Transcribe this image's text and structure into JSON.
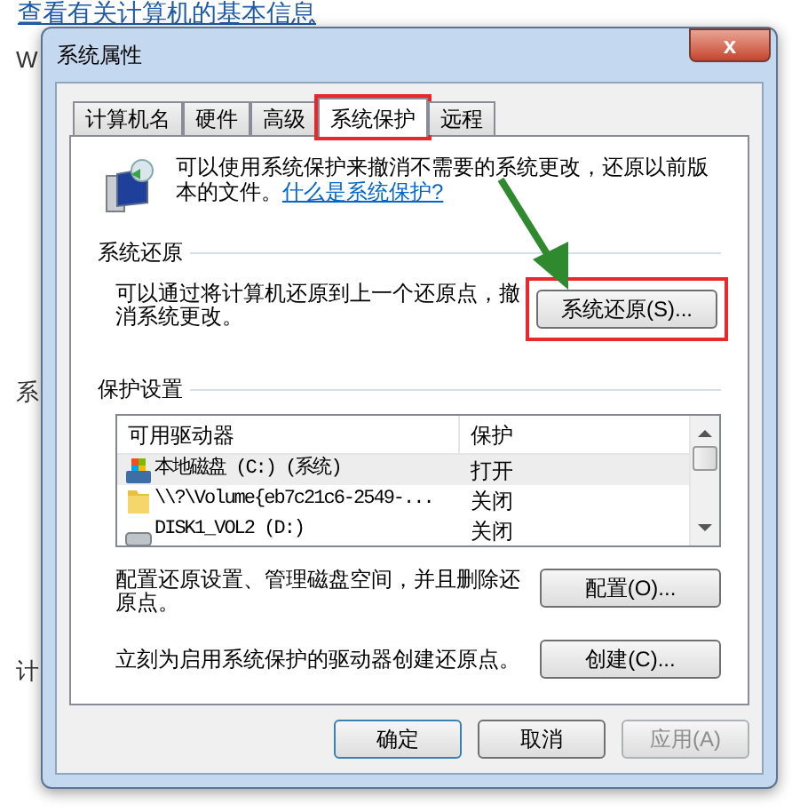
{
  "background": {
    "heading_link": "查看有关计算机的基本信息",
    "fragments": [
      "W",
      "系",
      "计"
    ]
  },
  "window": {
    "title": "系统属性",
    "close": "x"
  },
  "tabs": [
    {
      "label": "计算机名",
      "selected": false,
      "highlighted": false
    },
    {
      "label": "硬件",
      "selected": false,
      "highlighted": false
    },
    {
      "label": "高级",
      "selected": false,
      "highlighted": false
    },
    {
      "label": "系统保护",
      "selected": true,
      "highlighted": true
    },
    {
      "label": "远程",
      "selected": false,
      "highlighted": false
    }
  ],
  "intro": {
    "text": "可以使用系统保护来撤消不需要的系统更改，还原以前版本的文件。",
    "link": "什么是系统保护?"
  },
  "restore": {
    "heading": "系统还原",
    "text": "可以通过将计算机还原到上一个还原点，撤消系统更改。",
    "button": "系统还原(S)...",
    "highlighted": true
  },
  "protection": {
    "heading": "保护设置",
    "columns": [
      "可用驱动器",
      "保护"
    ],
    "rows": [
      {
        "kind": "system",
        "drive": "本地磁盘 (C:) (系统)",
        "protection": "打开",
        "selected": true
      },
      {
        "kind": "folder",
        "drive": "\\\\?\\Volume{eb7c21c6-2549-...",
        "protection": "关闭",
        "selected": false
      },
      {
        "kind": "disk",
        "drive": "DISK1_VOL2 (D:)",
        "protection": "关闭",
        "selected": false
      }
    ],
    "configure_text": "配置还原设置、管理磁盘空间，并且删除还原点。",
    "configure_button": "配置(O)...",
    "create_text": "立刻为启用系统保护的驱动器创建还原点。",
    "create_button": "创建(C)..."
  },
  "buttons": [
    {
      "label": "确定",
      "kind": "default"
    },
    {
      "label": "取消",
      "kind": "normal"
    },
    {
      "label": "应用(A)",
      "kind": "disabled"
    }
  ]
}
